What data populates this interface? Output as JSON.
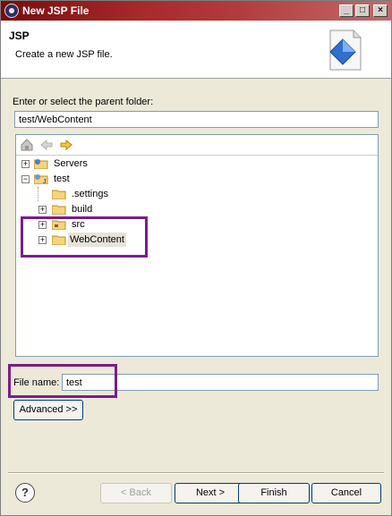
{
  "window": {
    "title": "New JSP File",
    "minimize": "_",
    "maximize": "□",
    "close": "×"
  },
  "header": {
    "title": "JSP",
    "message": "Create a new JSP file."
  },
  "folder": {
    "label": "Enter or select the parent folder:",
    "value": "test/WebContent"
  },
  "tree": {
    "toolbar": [
      "home-icon",
      "back-arrow-icon",
      "forward-arrow-icon"
    ],
    "items": [
      {
        "label": "Servers",
        "expander": "+"
      },
      {
        "label": "test",
        "expander": "−"
      },
      {
        "label": ".settings",
        "expander": ""
      },
      {
        "label": "build",
        "expander": "+"
      },
      {
        "label": "src",
        "expander": "+"
      },
      {
        "label": "WebContent",
        "expander": "+"
      }
    ]
  },
  "file_name": {
    "label": "File name:",
    "value": "test"
  },
  "buttons": {
    "advanced": "Advanced >>",
    "back": "< Back",
    "next": "Next >",
    "finish": "Finish",
    "cancel": "Cancel",
    "help": "?"
  },
  "colors": {
    "title_bar": "#a52a2a",
    "highlight_box": "#7c1c8c"
  }
}
